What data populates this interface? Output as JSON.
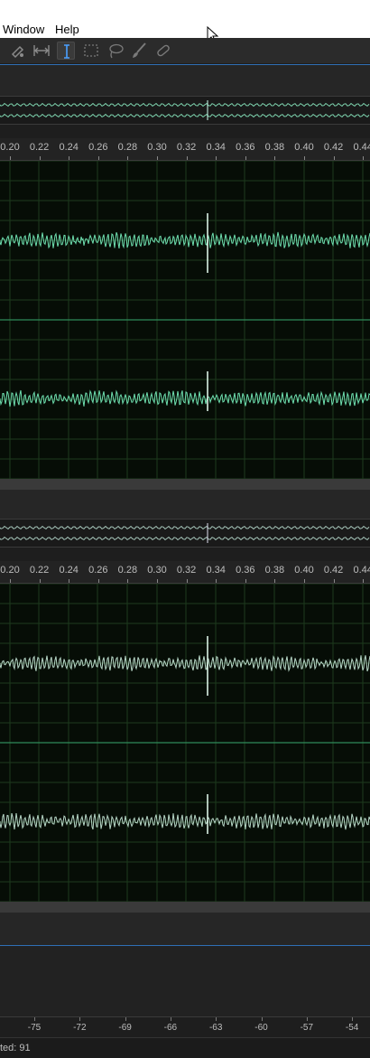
{
  "menu": {
    "items": [
      "Window",
      "Help"
    ]
  },
  "toolbar": {
    "tools": [
      {
        "name": "razor-icon"
      },
      {
        "name": "slip-icon"
      },
      {
        "name": "time-selection-icon",
        "active": true
      },
      {
        "name": "marquee-icon"
      },
      {
        "name": "lasso-icon"
      },
      {
        "name": "brush-icon"
      },
      {
        "name": "healing-icon"
      }
    ]
  },
  "ruler": {
    "labels": [
      "0.20",
      "0.22",
      "0.24",
      "0.26",
      "0.28",
      "0.30",
      "0.32",
      "0.34",
      "0.36",
      "0.38",
      "0.40",
      "0.42",
      "0.44"
    ]
  },
  "editors": [
    {
      "name": "top",
      "waveform_color": "#6fe0b0"
    },
    {
      "name": "bottom",
      "waveform_color": "#b8d8c8"
    }
  ],
  "meter": {
    "labels": [
      "-75",
      "-72",
      "-69",
      "-66",
      "-63",
      "-60",
      "-57",
      "-54"
    ]
  },
  "status": {
    "text": "ted: 91"
  },
  "colors": {
    "accent_blue": "#2f6fb5",
    "grid": "#1d3a1d",
    "centerline": "#2f8a5a"
  }
}
